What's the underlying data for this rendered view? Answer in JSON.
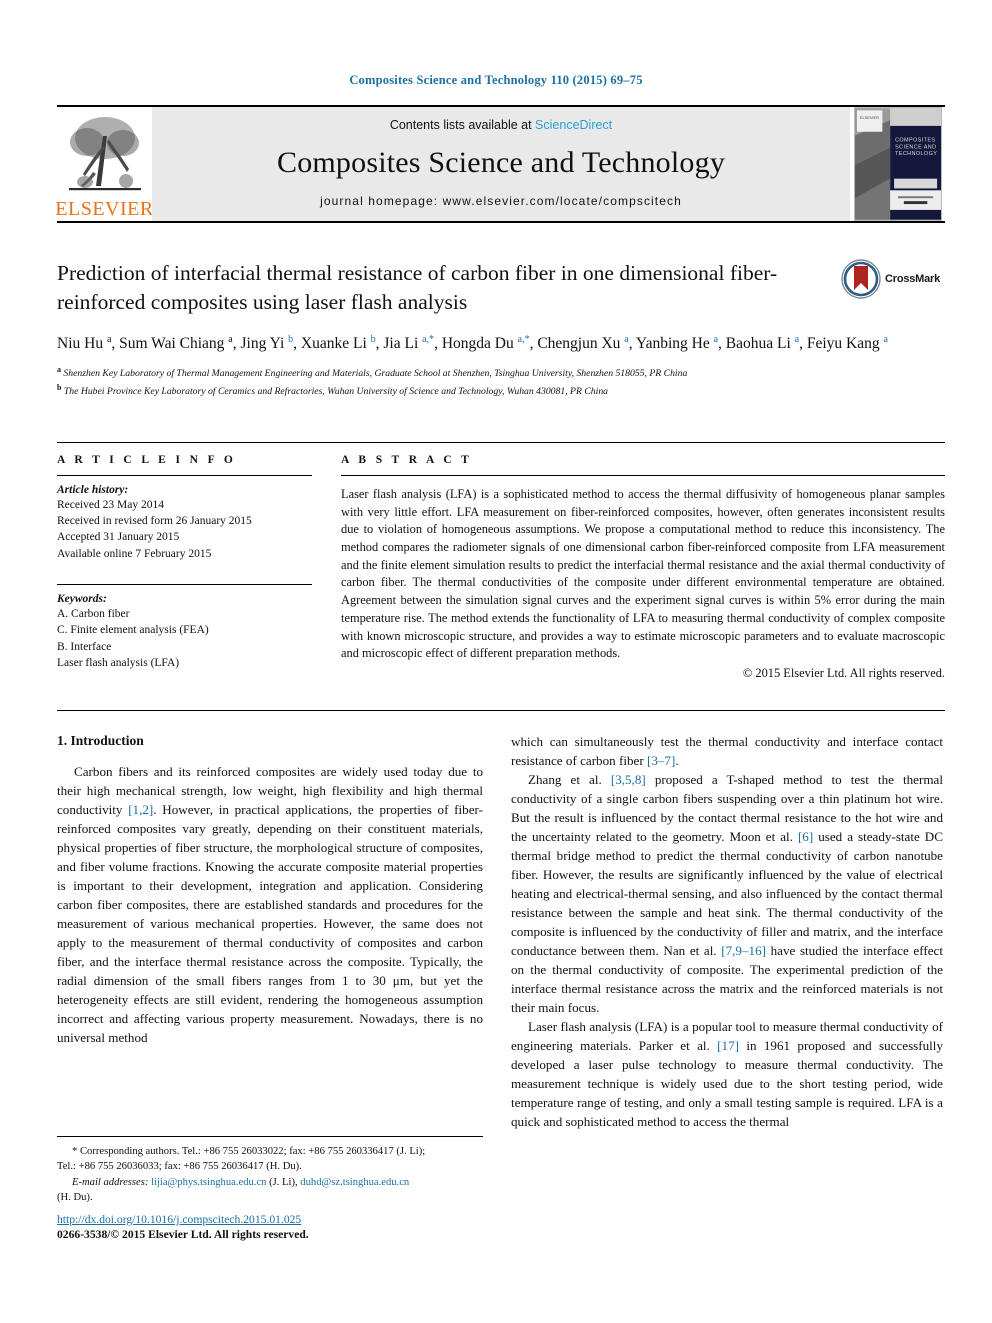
{
  "running_head": "Composites Science and Technology 110 (2015) 69–75",
  "masthead": {
    "publisher_name": "ELSEVIER",
    "contents_prefix": "Contents lists available at ",
    "sciencedirect": "ScienceDirect",
    "journal_title": "Composites Science and Technology",
    "homepage": "journal homepage: www.elsevier.com/locate/compscitech",
    "cover_title": "COMPOSITES SCIENCE AND TECHNOLOGY"
  },
  "article": {
    "title": "Prediction of interfacial thermal resistance of carbon fiber in one dimensional fiber-reinforced composites using laser flash analysis",
    "crossmark_label": "CrossMark",
    "authors": "Niu Hu a, Sum Wai Chiang a, Jing Yi b, Xuanke Li b, Jia Li a,*, Hongda Du a,*, Chengjun Xu a, Yanbing He a, Baohua Li a, Feiyu Kang a",
    "affiliation_a": "Shenzhen Key Laboratory of Thermal Management Engineering and Materials, Graduate School at Shenzhen, Tsinghua University, Shenzhen 518055, PR China",
    "affiliation_b": "The Hubei Province Key Laboratory of Ceramics and Refractories, Wuhan University of Science and Technology, Wuhan 430081, PR China"
  },
  "article_info": {
    "heading": "A R T I C L E  I N F O",
    "history_label": "Article history:",
    "history": [
      "Received 23 May 2014",
      "Received in revised form 26 January 2015",
      "Accepted 31 January 2015",
      "Available online 7 February 2015"
    ],
    "keywords_label": "Keywords:",
    "keywords": [
      "A. Carbon fiber",
      "C. Finite element analysis (FEA)",
      "B. Interface",
      "Laser flash analysis (LFA)"
    ]
  },
  "abstract": {
    "heading": "A B S T R A C T",
    "text": "Laser flash analysis (LFA) is a sophisticated method to access the thermal diffusivity of homogeneous planar samples with very little effort. LFA measurement on fiber-reinforced composites, however, often generates inconsistent results due to violation of homogeneous assumptions. We propose a computational method to reduce this inconsistency. The method compares the radiometer signals of one dimensional carbon fiber-reinforced composite from LFA measurement and the finite element simulation results to predict the interfacial thermal resistance and the axial thermal conductivity of carbon fiber. The thermal conductivities of the composite under different environmental temperature are obtained. Agreement between the simulation signal curves and the experiment signal curves is within 5% error during the main temperature rise. The method extends the functionality of LFA to measuring thermal conductivity of complex composite with known microscopic structure, and provides a way to estimate microscopic parameters and to evaluate macroscopic and microscopic effect of different preparation methods.",
    "copyright": "© 2015 Elsevier Ltd. All rights reserved."
  },
  "body": {
    "section_title": "1. Introduction",
    "left_paragraph_1": "Carbon fibers and its reinforced composites are widely used today due to their high mechanical strength, low weight, high flexibility and high thermal conductivity [1,2]. However, in practical applications, the properties of fiber-reinforced composites vary greatly, depending on their constituent materials, physical properties of fiber structure, the morphological structure of composites, and fiber volume fractions. Knowing the accurate composite material properties is important to their development, integration and application. Considering carbon fiber composites, there are established standards and procedures for the measurement of various mechanical properties. However, the same does not apply to the measurement of thermal conductivity of composites and carbon fiber, and the interface thermal resistance across the composite. Typically, the radial dimension of the small fibers ranges from 1 to 30 μm, but yet the heterogeneity effects are still evident, rendering the homogeneous assumption incorrect and affecting various property measurement. Nowadays, there is no universal method",
    "right_paragraph_1": "which can simultaneously test the thermal conductivity and interface contact resistance of carbon fiber [3–7].",
    "right_paragraph_2": "Zhang et al. [3,5,8] proposed a T-shaped method to test the thermal conductivity of a single carbon fibers suspending over a thin platinum hot wire. But the result is influenced by the contact thermal resistance to the hot wire and the uncertainty related to the geometry. Moon et al. [6] used a steady-state DC thermal bridge method to predict the thermal conductivity of carbon nanotube fiber. However, the results are significantly influenced by the value of electrical heating and electrical-thermal sensing, and also influenced by the contact thermal resistance between the sample and heat sink. The thermal conductivity of the composite is influenced by the conductivity of filler and matrix, and the interface conductance between them. Nan et al. [7,9–16] have studied the interface effect on the thermal conductivity of composite. The experimental prediction of the interface thermal resistance across the matrix and the reinforced materials is not their main focus.",
    "right_paragraph_3": "Laser flash analysis (LFA) is a popular tool to measure thermal conductivity of engineering materials. Parker et al. [17] in 1961 proposed and successfully developed a laser pulse technology to measure thermal conductivity. The measurement technique is widely used due to the short testing period, wide temperature range of testing, and only a small testing sample is required. LFA is a quick and sophisticated method to access the thermal"
  },
  "footnote": {
    "corresponding": "* Corresponding authors. Tel.: +86 755 26033022; fax: +86 755 260336417 (J. Li);",
    "corresponding_line2": "Tel.: +86 755 26036033; fax: +86 755 26036417 (H. Du).",
    "email_label": "E-mail addresses:",
    "email_1": "lijia@phys.tsinghua.edu.cn",
    "email_1_suffix": " (J. Li),",
    "email_2": "duhd@sz.tsinghua.edu.cn",
    "email_2_suffix": "(H. Du)."
  },
  "bottom": {
    "doi": "http://dx.doi.org/10.1016/j.compscitech.2015.01.025",
    "issn": "0266-3538/© 2015 Elsevier Ltd. All rights reserved."
  },
  "colors": {
    "link": "#1a6fa3",
    "sciencedirect": "#2a9ed6",
    "elsevier_orange": "#E9711C",
    "masthead_gray": "#e9e9e9"
  }
}
